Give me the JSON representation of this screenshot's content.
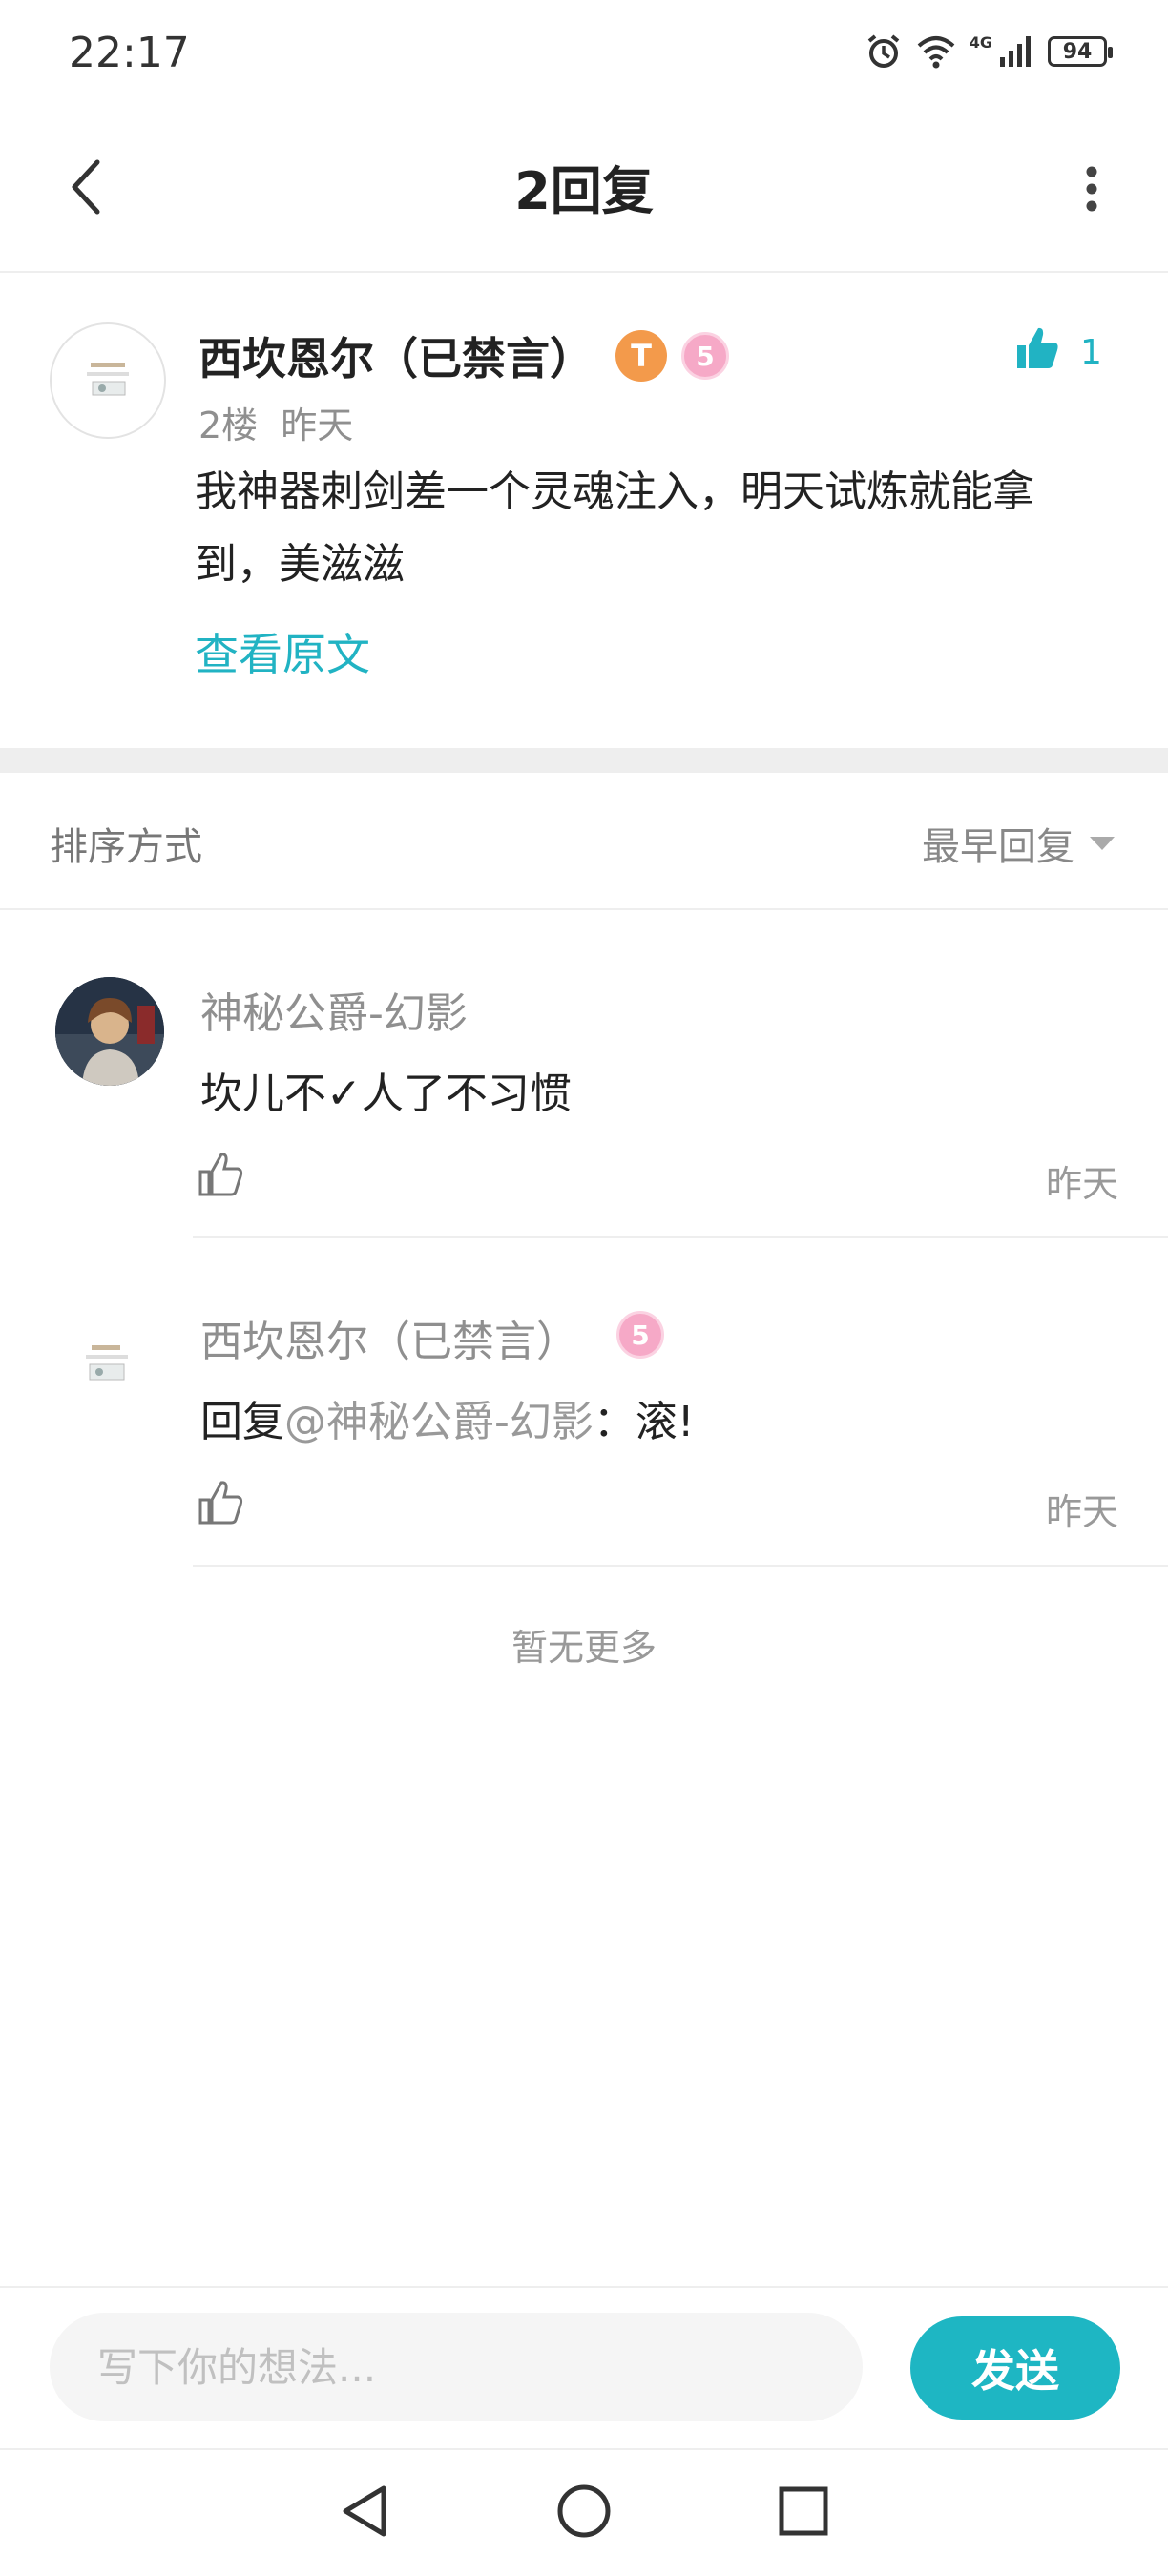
{
  "status_bar": {
    "time": "22:17",
    "network": "4G",
    "battery": "94",
    "icons": [
      "alarm-icon",
      "wifi-icon",
      "signal-icon",
      "battery-icon"
    ]
  },
  "header": {
    "title": "2回复",
    "back_icon": "chevron-left-icon",
    "more_icon": "more-vertical-icon"
  },
  "main_post": {
    "author": "西坎恩尔（已禁言）",
    "badge_t": "T",
    "badge_level": "5",
    "like_count": "1",
    "floor": "2楼",
    "time": "昨天",
    "content": "我神器刺剑差一个灵魂注入，明天试炼就能拿到，美滋滋",
    "view_original": "查看原文"
  },
  "sort": {
    "label": "排序方式",
    "value": "最早回复"
  },
  "replies": [
    {
      "author": "神秘公爵-幻影",
      "content": "坎儿不✓人了不习惯",
      "time": "昨天"
    },
    {
      "author": "西坎恩尔（已禁言）",
      "badge_level": "5",
      "reply_prefix": "回复",
      "mention": "@神秘公爵-幻影",
      "content_suffix": "：滚!",
      "time": "昨天"
    }
  ],
  "no_more_text": "暂无更多",
  "composer": {
    "placeholder": "写下你的想法...",
    "send_label": "发送"
  },
  "colors": {
    "accent": "#1eb6c3",
    "meta_gray": "#8f8f8f",
    "divider": "#eeeeee"
  }
}
